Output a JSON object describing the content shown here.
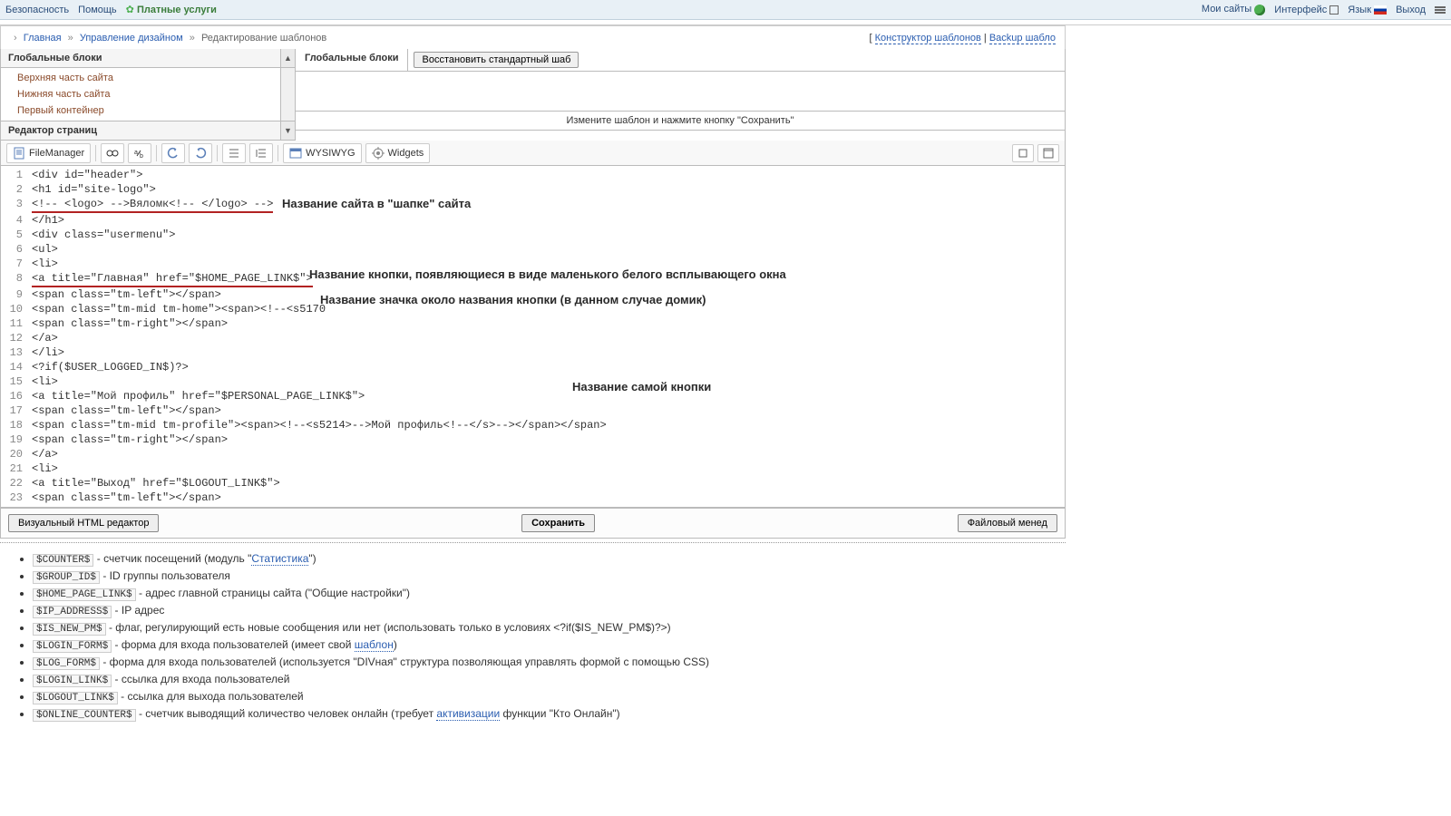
{
  "topbar": {
    "left": [
      "Безопасность",
      "Помощь"
    ],
    "paid": "Платные услуги",
    "right": [
      "Мои сайты",
      "Интерфейс",
      "Язык",
      "Выход"
    ]
  },
  "breadcrumb": {
    "items": [
      "Главная",
      "Управление дизайном",
      "Редактирование шаблонов"
    ],
    "right": {
      "constructor": "Конструктор шаблонов",
      "backup": "Backup шабло"
    }
  },
  "sidebar": {
    "section1_title": "Глобальные блоки",
    "items": [
      "Верхняя часть сайта",
      "Нижняя часть сайта",
      "Первый контейнер"
    ],
    "section2_title": "Редактор страниц"
  },
  "main": {
    "header": "Глобальные блоки",
    "restore_btn": "Восстановить стандартный шаб",
    "hint": "Измените шаблон и нажмите кнопку \"Сохранить\""
  },
  "toolbar": {
    "filemanager": "FileManager",
    "wysiwyg": "WYSIWYG",
    "widgets": "Widgets"
  },
  "code": [
    "<div id=\"header\">",
    "<h1 id=\"site-logo\">",
    "<!-- <logo> -->Вяломк<!-- </logo> -->",
    "</h1>",
    "<div class=\"usermenu\">",
    "<ul>",
    "<li>",
    "<a title=\"Главная\" href=\"$HOME_PAGE_LINK$\">",
    "<span class=\"tm-left\"></span>",
    "<span class=\"tm-mid tm-home\"><span><!--<s5170",
    "<span class=\"tm-right\"></span>",
    "</a>",
    "</li>",
    "<?if($USER_LOGGED_IN$)?>",
    "<li>",
    "<a title=\"Мой профиль\" href=\"$PERSONAL_PAGE_LINK$\">",
    "<span class=\"tm-left\"></span>",
    "<span class=\"tm-mid tm-profile\"><span><!--<s5214>-->Мой профиль<!--</s>--></span></span>",
    "<span class=\"tm-right\"></span>",
    "</a>",
    "<li>",
    "<a title=\"Выход\" href=\"$LOGOUT_LINK$\">",
    "<span class=\"tm-left\"></span>"
  ],
  "annotations": {
    "a1": "Название сайта в \"шапке\" сайта",
    "a2": "Название кнопки, появляющиеся в виде маленького белого всплывающего окна",
    "a3": "Название значка около названия кнопки (в данном случае домик)",
    "a4": "Название самой кнопки"
  },
  "bottom": {
    "visual": "Визуальный HTML редактор",
    "save": "Сохранить",
    "filemgr": "Файловый менед"
  },
  "vars": [
    {
      "code": "$COUNTER$",
      "desc": " - счетчик посещений (модуль \"",
      "link": "Статистика",
      "tail": "\")"
    },
    {
      "code": "$GROUP_ID$",
      "desc": " - ID группы пользователя"
    },
    {
      "code": "$HOME_PAGE_LINK$",
      "desc": " - адрес главной страницы сайта (\"Общие настройки\")"
    },
    {
      "code": "$IP_ADDRESS$",
      "desc": " - IP адрес"
    },
    {
      "code": "$IS_NEW_PM$",
      "desc": " - флаг, регулирующий есть новые сообщения или нет (использовать только в условиях <?if($IS_NEW_PM$)?>)"
    },
    {
      "code": "$LOGIN_FORM$",
      "desc": " - форма для входа пользователей (имеет свой ",
      "link": "шаблон",
      "tail": ")"
    },
    {
      "code": "$LOG_FORM$",
      "desc": " - форма для входа пользователей (используется \"DIVная\" структура позволяющая управлять формой с помощью CSS)"
    },
    {
      "code": "$LOGIN_LINK$",
      "desc": " - ссылка для входа пользователей"
    },
    {
      "code": "$LOGOUT_LINK$",
      "desc": " - ссылка для выхода пользователей"
    },
    {
      "code": "$ONLINE_COUNTER$",
      "desc": " - счетчик выводящий количество человек онлайн (требует ",
      "link": "активизации",
      "tail": " функции \"Кто Онлайн\")"
    }
  ]
}
